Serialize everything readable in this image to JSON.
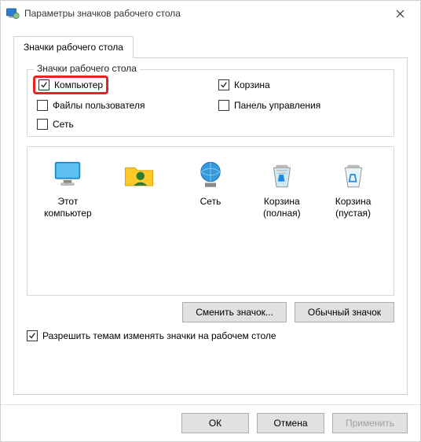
{
  "window": {
    "title": "Параметры значков рабочего стола"
  },
  "tab": {
    "label": "Значки рабочего стола"
  },
  "group": {
    "title": "Значки рабочего стола"
  },
  "checks": {
    "computer": {
      "label": "Компьютер",
      "checked": true
    },
    "recyclebin": {
      "label": "Корзина",
      "checked": true
    },
    "userfiles": {
      "label": "Файлы пользователя",
      "checked": false
    },
    "controlpanel": {
      "label": "Панель управления",
      "checked": false
    },
    "network": {
      "label": "Сеть",
      "checked": false
    }
  },
  "icons": {
    "this_pc": "Этот компьютер",
    "user": " ",
    "network": "Сеть",
    "bin_full": "Корзина (полная)",
    "bin_empty": "Корзина (пустая)"
  },
  "buttons": {
    "change_icon": "Сменить значок...",
    "default_icon": "Обычный значок",
    "ok": "ОК",
    "cancel": "Отмена",
    "apply": "Применить"
  },
  "allow_themes": {
    "label": "Разрешить темам изменять значки на рабочем столе",
    "checked": true
  }
}
